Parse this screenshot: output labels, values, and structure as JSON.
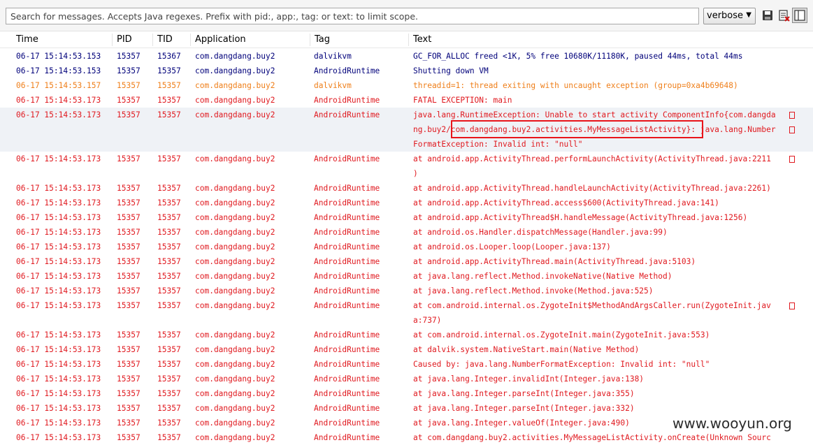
{
  "toolbar": {
    "search_placeholder": "Search for messages. Accepts Java regexes. Prefix with pid:, app:, tag: or text: to limit scope.",
    "log_level": "verbose",
    "icons": [
      "save-icon",
      "clear-log-icon",
      "toggle-columns-icon"
    ]
  },
  "columns": [
    "Time",
    "PID",
    "TID",
    "Application",
    "Tag",
    "Text"
  ],
  "colors": {
    "debug": "#00007a",
    "warning": "#ef7f1a",
    "error": "#e0191f",
    "highlight_box": "#e8141a"
  },
  "rows": [
    {
      "level": "D",
      "time": "06-17 15:14:53.153",
      "pid": "15357",
      "tid": "15367",
      "app": "com.dangdang.buy2",
      "tag": "dalvikvm",
      "text": [
        "GC_FOR_ALLOC freed <1K, 5% free 10680K/11180K, paused 44ms, total 44ms"
      ]
    },
    {
      "level": "D",
      "time": "06-17 15:14:53.153",
      "pid": "15357",
      "tid": "15357",
      "app": "com.dangdang.buy2",
      "tag": "AndroidRuntime",
      "text": [
        "Shutting down VM"
      ]
    },
    {
      "level": "W",
      "time": "06-17 15:14:53.157",
      "pid": "15357",
      "tid": "15357",
      "app": "com.dangdang.buy2",
      "tag": "dalvikvm",
      "text": [
        "threadid=1: thread exiting with uncaught exception (group=0xa4b69648)"
      ]
    },
    {
      "level": "E",
      "time": "06-17 15:14:53.173",
      "pid": "15357",
      "tid": "15357",
      "app": "com.dangdang.buy2",
      "tag": "AndroidRuntime",
      "text": [
        "FATAL EXCEPTION: main"
      ]
    },
    {
      "level": "E",
      "time": "06-17 15:14:53.173",
      "pid": "15357",
      "tid": "15357",
      "app": "com.dangdang.buy2",
      "tag": "AndroidRuntime",
      "text": [
        "java.lang.RuntimeException: Unable to start activity ComponentInfo{com.dangda",
        "ng.buy2/com.dangdang.buy2.activities.MyMessageListActivity}: java.lang.Number",
        "FormatException: Invalid int: \"null\""
      ],
      "selected": true
    },
    {
      "level": "E",
      "time": "06-17 15:14:53.173",
      "pid": "15357",
      "tid": "15357",
      "app": "com.dangdang.buy2",
      "tag": "AndroidRuntime",
      "text": [
        "at android.app.ActivityThread.performLaunchActivity(ActivityThread.java:2211",
        ")"
      ]
    },
    {
      "level": "E",
      "time": "06-17 15:14:53.173",
      "pid": "15357",
      "tid": "15357",
      "app": "com.dangdang.buy2",
      "tag": "AndroidRuntime",
      "text": [
        "at android.app.ActivityThread.handleLaunchActivity(ActivityThread.java:2261)"
      ]
    },
    {
      "level": "E",
      "time": "06-17 15:14:53.173",
      "pid": "15357",
      "tid": "15357",
      "app": "com.dangdang.buy2",
      "tag": "AndroidRuntime",
      "text": [
        "at android.app.ActivityThread.access$600(ActivityThread.java:141)"
      ]
    },
    {
      "level": "E",
      "time": "06-17 15:14:53.173",
      "pid": "15357",
      "tid": "15357",
      "app": "com.dangdang.buy2",
      "tag": "AndroidRuntime",
      "text": [
        "at android.app.ActivityThread$H.handleMessage(ActivityThread.java:1256)"
      ]
    },
    {
      "level": "E",
      "time": "06-17 15:14:53.173",
      "pid": "15357",
      "tid": "15357",
      "app": "com.dangdang.buy2",
      "tag": "AndroidRuntime",
      "text": [
        "at android.os.Handler.dispatchMessage(Handler.java:99)"
      ]
    },
    {
      "level": "E",
      "time": "06-17 15:14:53.173",
      "pid": "15357",
      "tid": "15357",
      "app": "com.dangdang.buy2",
      "tag": "AndroidRuntime",
      "text": [
        "at android.os.Looper.loop(Looper.java:137)"
      ]
    },
    {
      "level": "E",
      "time": "06-17 15:14:53.173",
      "pid": "15357",
      "tid": "15357",
      "app": "com.dangdang.buy2",
      "tag": "AndroidRuntime",
      "text": [
        "at android.app.ActivityThread.main(ActivityThread.java:5103)"
      ]
    },
    {
      "level": "E",
      "time": "06-17 15:14:53.173",
      "pid": "15357",
      "tid": "15357",
      "app": "com.dangdang.buy2",
      "tag": "AndroidRuntime",
      "text": [
        "at java.lang.reflect.Method.invokeNative(Native Method)"
      ]
    },
    {
      "level": "E",
      "time": "06-17 15:14:53.173",
      "pid": "15357",
      "tid": "15357",
      "app": "com.dangdang.buy2",
      "tag": "AndroidRuntime",
      "text": [
        "at java.lang.reflect.Method.invoke(Method.java:525)"
      ]
    },
    {
      "level": "E",
      "time": "06-17 15:14:53.173",
      "pid": "15357",
      "tid": "15357",
      "app": "com.dangdang.buy2",
      "tag": "AndroidRuntime",
      "text": [
        "at com.android.internal.os.ZygoteInit$MethodAndArgsCaller.run(ZygoteInit.jav",
        "a:737)"
      ]
    },
    {
      "level": "E",
      "time": "06-17 15:14:53.173",
      "pid": "15357",
      "tid": "15357",
      "app": "com.dangdang.buy2",
      "tag": "AndroidRuntime",
      "text": [
        "at com.android.internal.os.ZygoteInit.main(ZygoteInit.java:553)"
      ]
    },
    {
      "level": "E",
      "time": "06-17 15:14:53.173",
      "pid": "15357",
      "tid": "15357",
      "app": "com.dangdang.buy2",
      "tag": "AndroidRuntime",
      "text": [
        "at dalvik.system.NativeStart.main(Native Method)"
      ]
    },
    {
      "level": "E",
      "time": "06-17 15:14:53.173",
      "pid": "15357",
      "tid": "15357",
      "app": "com.dangdang.buy2",
      "tag": "AndroidRuntime",
      "text": [
        "Caused by: java.lang.NumberFormatException: Invalid int: \"null\""
      ]
    },
    {
      "level": "E",
      "time": "06-17 15:14:53.173",
      "pid": "15357",
      "tid": "15357",
      "app": "com.dangdang.buy2",
      "tag": "AndroidRuntime",
      "text": [
        "at java.lang.Integer.invalidInt(Integer.java:138)"
      ]
    },
    {
      "level": "E",
      "time": "06-17 15:14:53.173",
      "pid": "15357",
      "tid": "15357",
      "app": "com.dangdang.buy2",
      "tag": "AndroidRuntime",
      "text": [
        "at java.lang.Integer.parseInt(Integer.java:355)"
      ]
    },
    {
      "level": "E",
      "time": "06-17 15:14:53.173",
      "pid": "15357",
      "tid": "15357",
      "app": "com.dangdang.buy2",
      "tag": "AndroidRuntime",
      "text": [
        "at java.lang.Integer.parseInt(Integer.java:332)"
      ]
    },
    {
      "level": "E",
      "time": "06-17 15:14:53.173",
      "pid": "15357",
      "tid": "15357",
      "app": "com.dangdang.buy2",
      "tag": "AndroidRuntime",
      "text": [
        "at java.lang.Integer.valueOf(Integer.java:490)"
      ]
    },
    {
      "level": "E",
      "time": "06-17 15:14:53.173",
      "pid": "15357",
      "tid": "15357",
      "app": "com.dangdang.buy2",
      "tag": "AndroidRuntime",
      "text": [
        "at com.dangdang.buy2.activities.MyMessageListActivity.onCreate(Unknown Sourc"
      ]
    }
  ],
  "watermark": "www.wooyun.org"
}
